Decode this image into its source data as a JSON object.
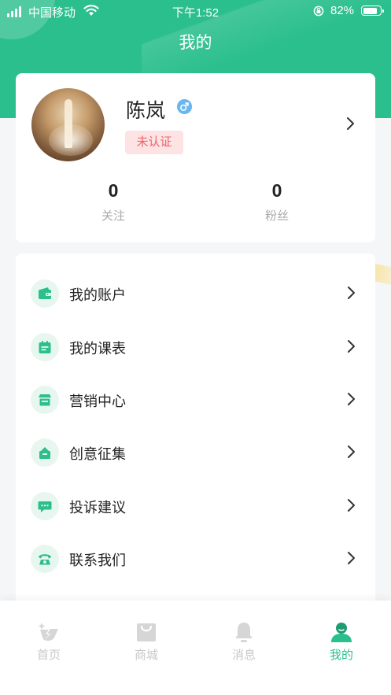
{
  "status_bar": {
    "carrier": "中国移动",
    "time": "下午1:52",
    "battery": "82%",
    "battery_level": 0.82
  },
  "page": {
    "title": "我的"
  },
  "profile": {
    "name": "陈岚",
    "gender_symbol": "♂",
    "cert_status": "未认证",
    "stats": [
      {
        "value": "0",
        "label": "关注"
      },
      {
        "value": "0",
        "label": "粉丝"
      }
    ]
  },
  "menu": {
    "items": [
      {
        "label": "我的账户",
        "icon": "wallet-icon"
      },
      {
        "label": "我的课表",
        "icon": "schedule-icon"
      },
      {
        "label": "营销中心",
        "icon": "store-icon"
      },
      {
        "label": "创意征集",
        "icon": "idea-box-icon"
      },
      {
        "label": "投诉建议",
        "icon": "chat-bubble-icon"
      },
      {
        "label": "联系我们",
        "icon": "phone-icon"
      }
    ]
  },
  "tab_bar": {
    "tabs": [
      {
        "label": "首页",
        "icon": "home-icon"
      },
      {
        "label": "商城",
        "icon": "shopping-bag-icon"
      },
      {
        "label": "消息",
        "icon": "bell-icon"
      },
      {
        "label": "我的",
        "icon": "user-icon",
        "active": true
      }
    ]
  },
  "colors": {
    "primary": "#2bbf8d",
    "badge_bg": "#fde3e3",
    "badge_text": "#f0616a",
    "icon_bg": "#e8f6f0",
    "inactive": "#c8c8c8"
  }
}
